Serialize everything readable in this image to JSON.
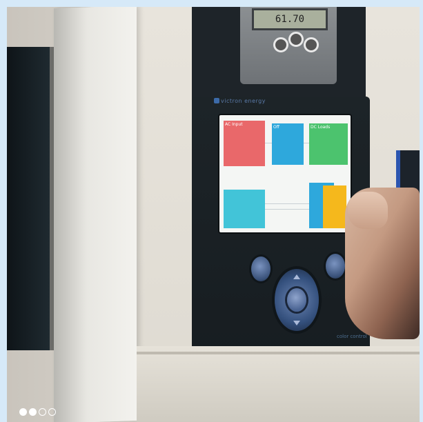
{
  "photo": {
    "top_monitor_display": "61.70",
    "panel_brand": "victron energy",
    "panel_model": "color control",
    "screen_tiles": [
      {
        "id": "ac-input",
        "label": "AC Input",
        "color": "#e9686a"
      },
      {
        "id": "multiplus",
        "label": "Off",
        "color": "#2ea8dc"
      },
      {
        "id": "dc-loads",
        "label": "DC Loads",
        "color": "#4cc36e"
      },
      {
        "id": "pv-charger",
        "label": "",
        "color": "#42c4d8"
      },
      {
        "id": "battery",
        "label": "",
        "color": "#2ea8dc"
      },
      {
        "id": "solar",
        "label": "",
        "color": "#f5b81c"
      }
    ]
  },
  "carousel": {
    "total": 4,
    "active": [
      true,
      true,
      false,
      false
    ]
  },
  "colors": {
    "page_border": "#d6e9f8",
    "panel": "#1d2428",
    "button_blue": "#4a6493"
  }
}
